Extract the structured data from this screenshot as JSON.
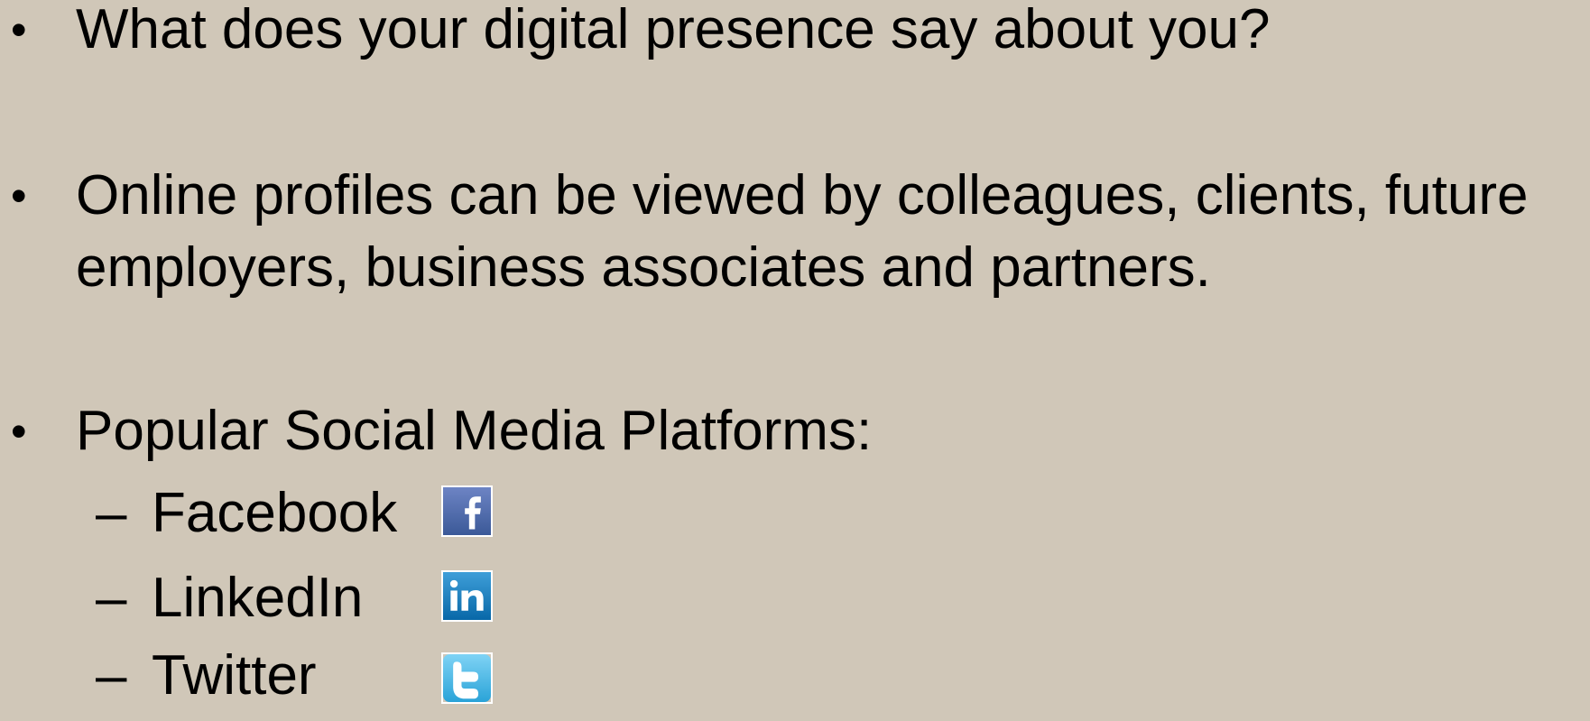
{
  "bullets": [
    {
      "marker": "•",
      "text": "What does your digital presence say about you?"
    },
    {
      "marker": "•",
      "text": "Online profiles can be viewed by colleagues, clients, future\nemployers, business associates and partners."
    },
    {
      "marker": "•",
      "text": "Popular Social Media Platforms:"
    }
  ],
  "platforms": [
    {
      "dash": "–",
      "label": "Facebook",
      "icon": "facebook-logo-icon"
    },
    {
      "dash": "–",
      "label": "LinkedIn",
      "icon": "linkedin-logo-icon"
    },
    {
      "dash": "–",
      "label": "Twitter",
      "icon": "twitter-logo-icon"
    }
  ],
  "colors": {
    "background": "#D0C7B8",
    "text": "#000000",
    "facebook": "#3B5998",
    "linkedin": "#0077B5",
    "twitter": "#55ACEE"
  }
}
